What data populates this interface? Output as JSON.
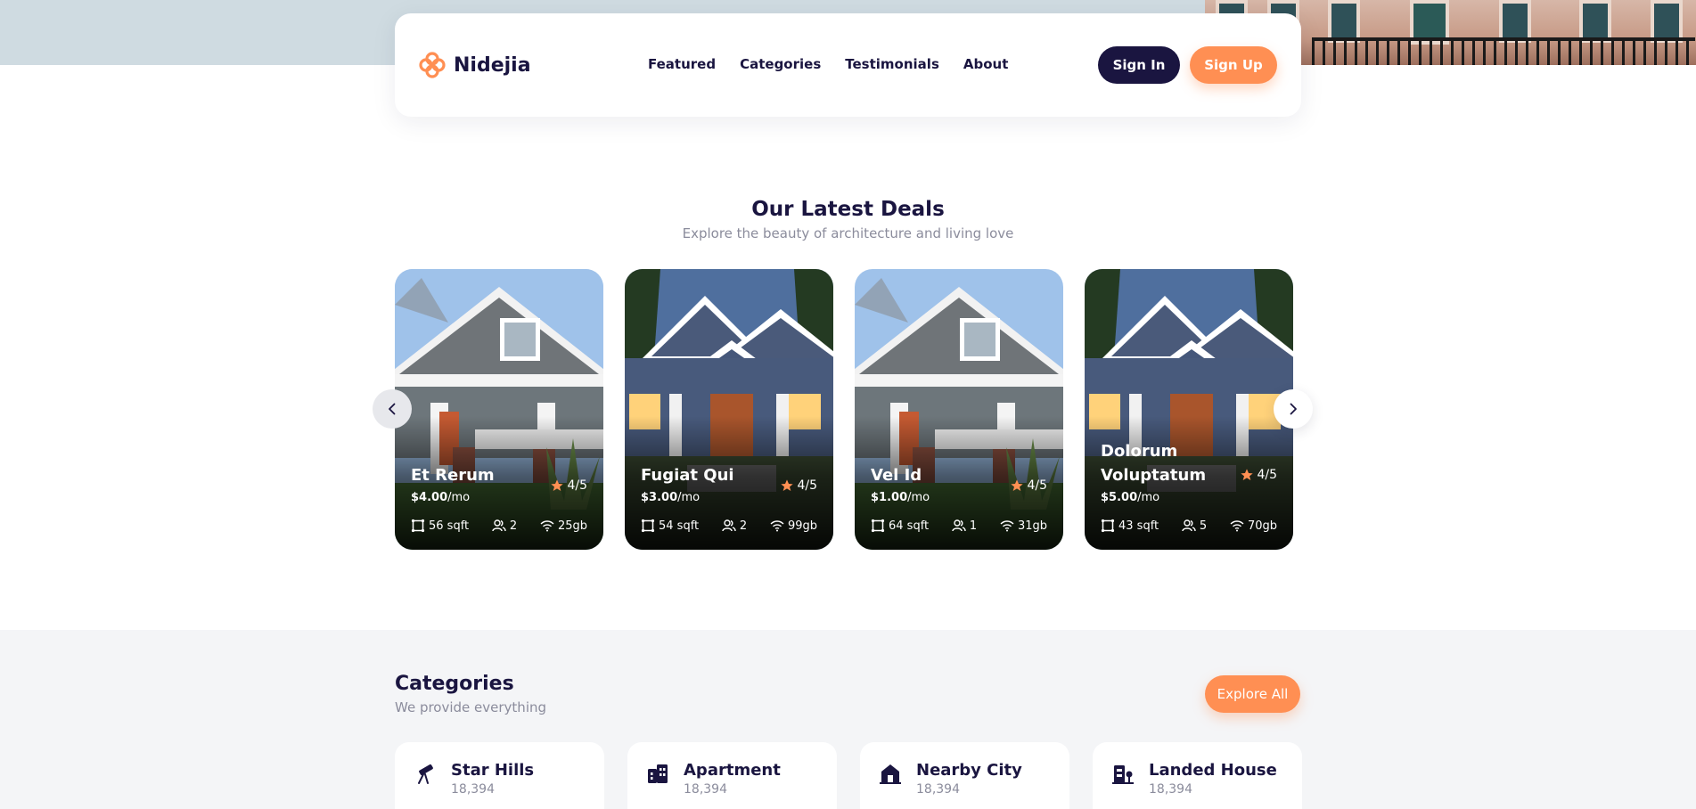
{
  "brand": {
    "name": "Nidejia",
    "logo_icon": "flower-logo-icon"
  },
  "nav": {
    "links": [
      {
        "label": "Featured"
      },
      {
        "label": "Categories"
      },
      {
        "label": "Testimonials"
      },
      {
        "label": "About"
      }
    ],
    "sign_in_label": "Sign In",
    "sign_up_label": "Sign Up"
  },
  "deals": {
    "title": "Our Latest Deals",
    "subtitle": "Explore the beauty of architecture and living love",
    "prev_icon": "chevron-left-icon",
    "next_icon": "chevron-right-icon",
    "cards": [
      {
        "name": "Et Rerum",
        "price": "$4.00",
        "period": "/mo",
        "rating": "4/5",
        "area": "56 sqft",
        "people": "2",
        "wifi": "25gb",
        "image_style": "gray"
      },
      {
        "name": "Fugiat Qui",
        "price": "$3.00",
        "period": "/mo",
        "rating": "4/5",
        "area": "54 sqft",
        "people": "2",
        "wifi": "99gb",
        "image_style": "blue"
      },
      {
        "name": "Vel Id",
        "price": "$1.00",
        "period": "/mo",
        "rating": "4/5",
        "area": "64 sqft",
        "people": "1",
        "wifi": "31gb",
        "image_style": "gray"
      },
      {
        "name": "Dolorum Voluptatum",
        "price": "$5.00",
        "period": "/mo",
        "rating": "4/5",
        "area": "43 sqft",
        "people": "5",
        "wifi": "70gb",
        "image_style": "blue"
      }
    ]
  },
  "categories": {
    "title": "Categories",
    "subtitle": "We provide everything",
    "explore_label": "Explore All",
    "items": [
      {
        "name": "Star Hills",
        "count": "18,394",
        "icon": "telescope-icon"
      },
      {
        "name": "Apartment",
        "count": "18,394",
        "icon": "apartment-building-icon"
      },
      {
        "name": "Nearby City",
        "count": "18,394",
        "icon": "house-icon"
      },
      {
        "name": "Landed House",
        "count": "18,394",
        "icon": "landed-house-icon"
      }
    ]
  },
  "colors": {
    "primary": "#1a1540",
    "accent": "#ff8f53",
    "muted": "#8b8c9c",
    "section_bg": "#f4f5f7"
  }
}
